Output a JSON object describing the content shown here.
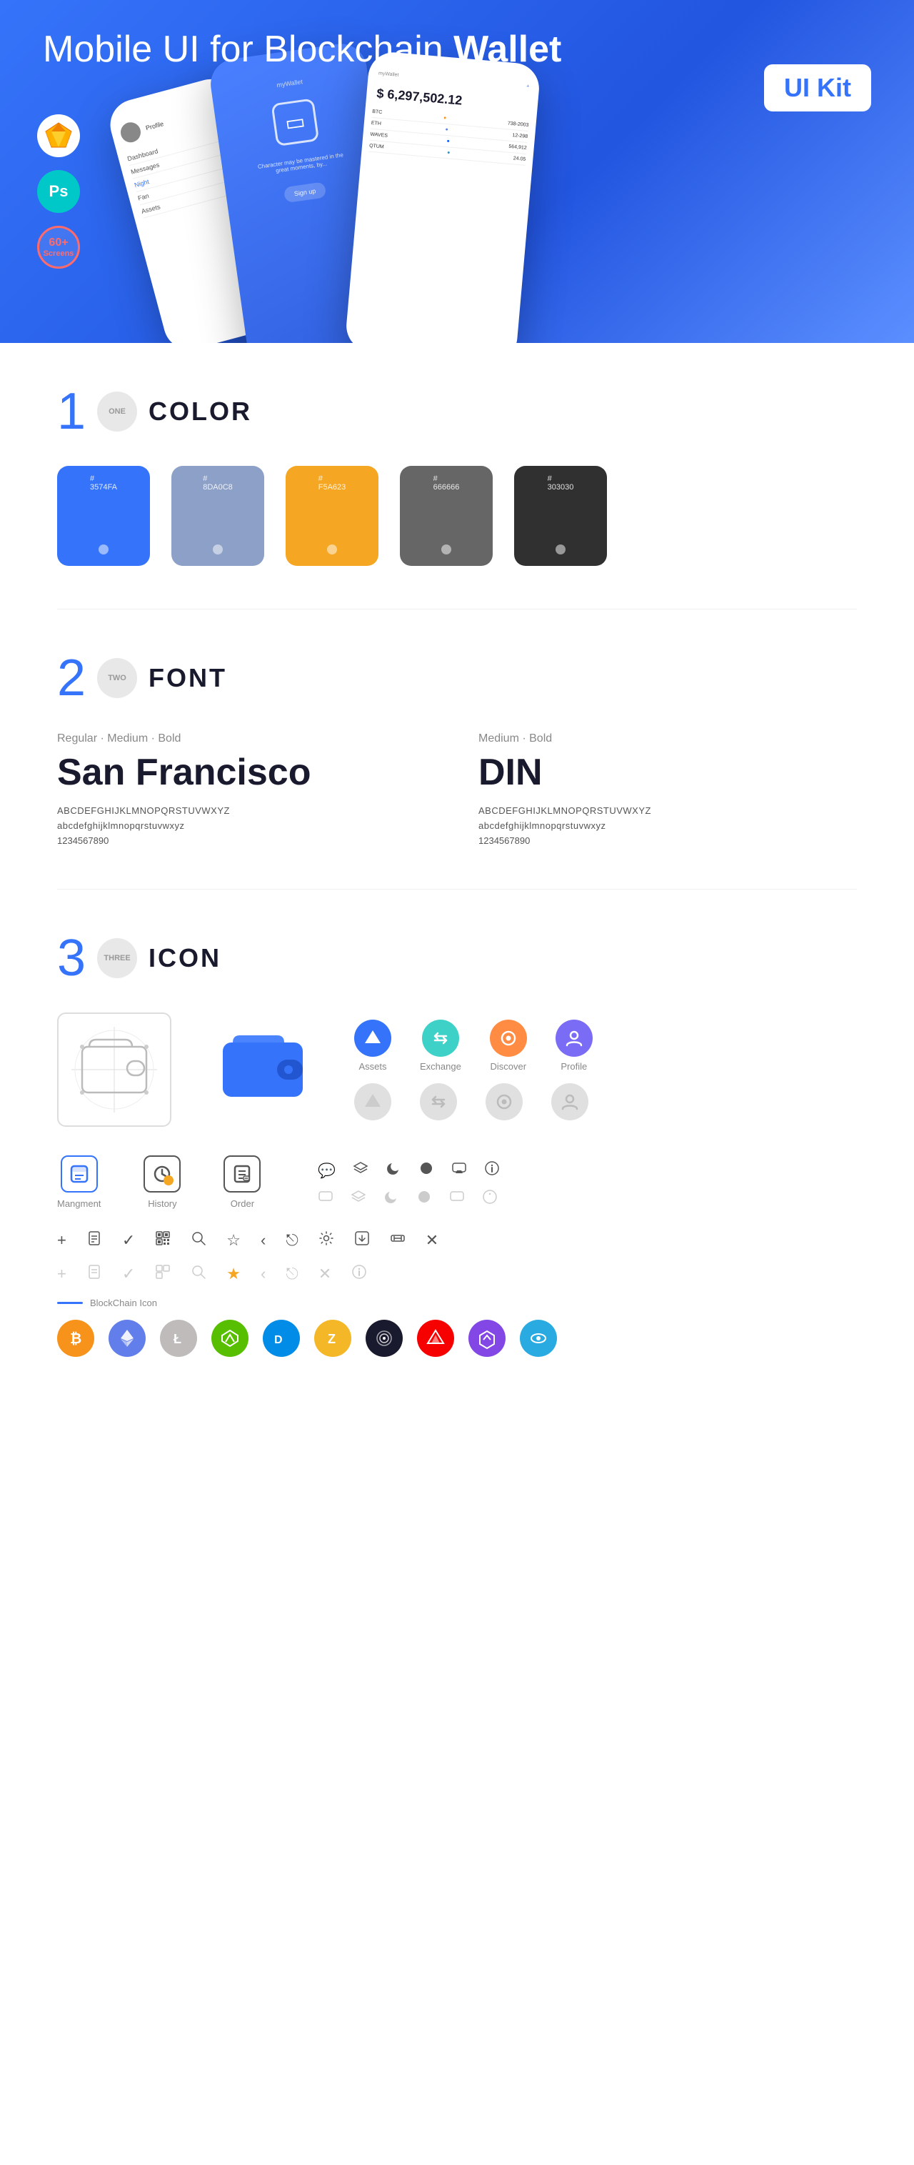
{
  "hero": {
    "title_plain": "Mobile UI for Blockchain ",
    "title_bold": "Wallet",
    "badge": "UI Kit",
    "sketch_label": "Sketch",
    "ps_label": "Ps",
    "screens_label": "60+\nScreens"
  },
  "section1": {
    "number": "1",
    "number_word": "ONE",
    "title": "COLOR",
    "swatches": [
      {
        "hex": "#3574FA",
        "label": "#\n3574FA"
      },
      {
        "hex": "#8DA0C8",
        "label": "#\n8DA0C8"
      },
      {
        "hex": "#F5A623",
        "label": "#\nF5A623"
      },
      {
        "hex": "#666666",
        "label": "#\n666666"
      },
      {
        "hex": "#303030",
        "label": "#\n303030"
      }
    ]
  },
  "section2": {
    "number": "2",
    "number_word": "TWO",
    "title": "FONT",
    "font1": {
      "style": "Regular · Medium · Bold",
      "name": "San Francisco",
      "upper": "ABCDEFGHIJKLMNOPQRSTUVWXYZ",
      "lower": "abcdefghijklmnopqrstuvwxyz",
      "nums": "1234567890"
    },
    "font2": {
      "style": "Medium · Bold",
      "name": "DIN",
      "upper": "ABCDEFGHIJKLMNOPQRSTUVWXYZ",
      "lower": "abcdefghijklmnopqrstuvwxyz",
      "nums": "1234567890"
    }
  },
  "section3": {
    "number": "3",
    "number_word": "THREE",
    "title": "ICON",
    "nav_icons": [
      {
        "label": "Assets",
        "color": "blue"
      },
      {
        "label": "Exchange",
        "color": "teal"
      },
      {
        "label": "Discover",
        "color": "orange"
      },
      {
        "label": "Profile",
        "color": "purple"
      }
    ],
    "app_icons": [
      {
        "label": "Mangment"
      },
      {
        "label": "History"
      },
      {
        "label": "Order"
      }
    ],
    "blockchain_label": "BlockChain Icon",
    "coins": [
      "BTC",
      "ETH",
      "LTC",
      "NEO",
      "DASH",
      "ZEC",
      "IOTA",
      "ARK",
      "MATIC",
      "SKY"
    ]
  }
}
